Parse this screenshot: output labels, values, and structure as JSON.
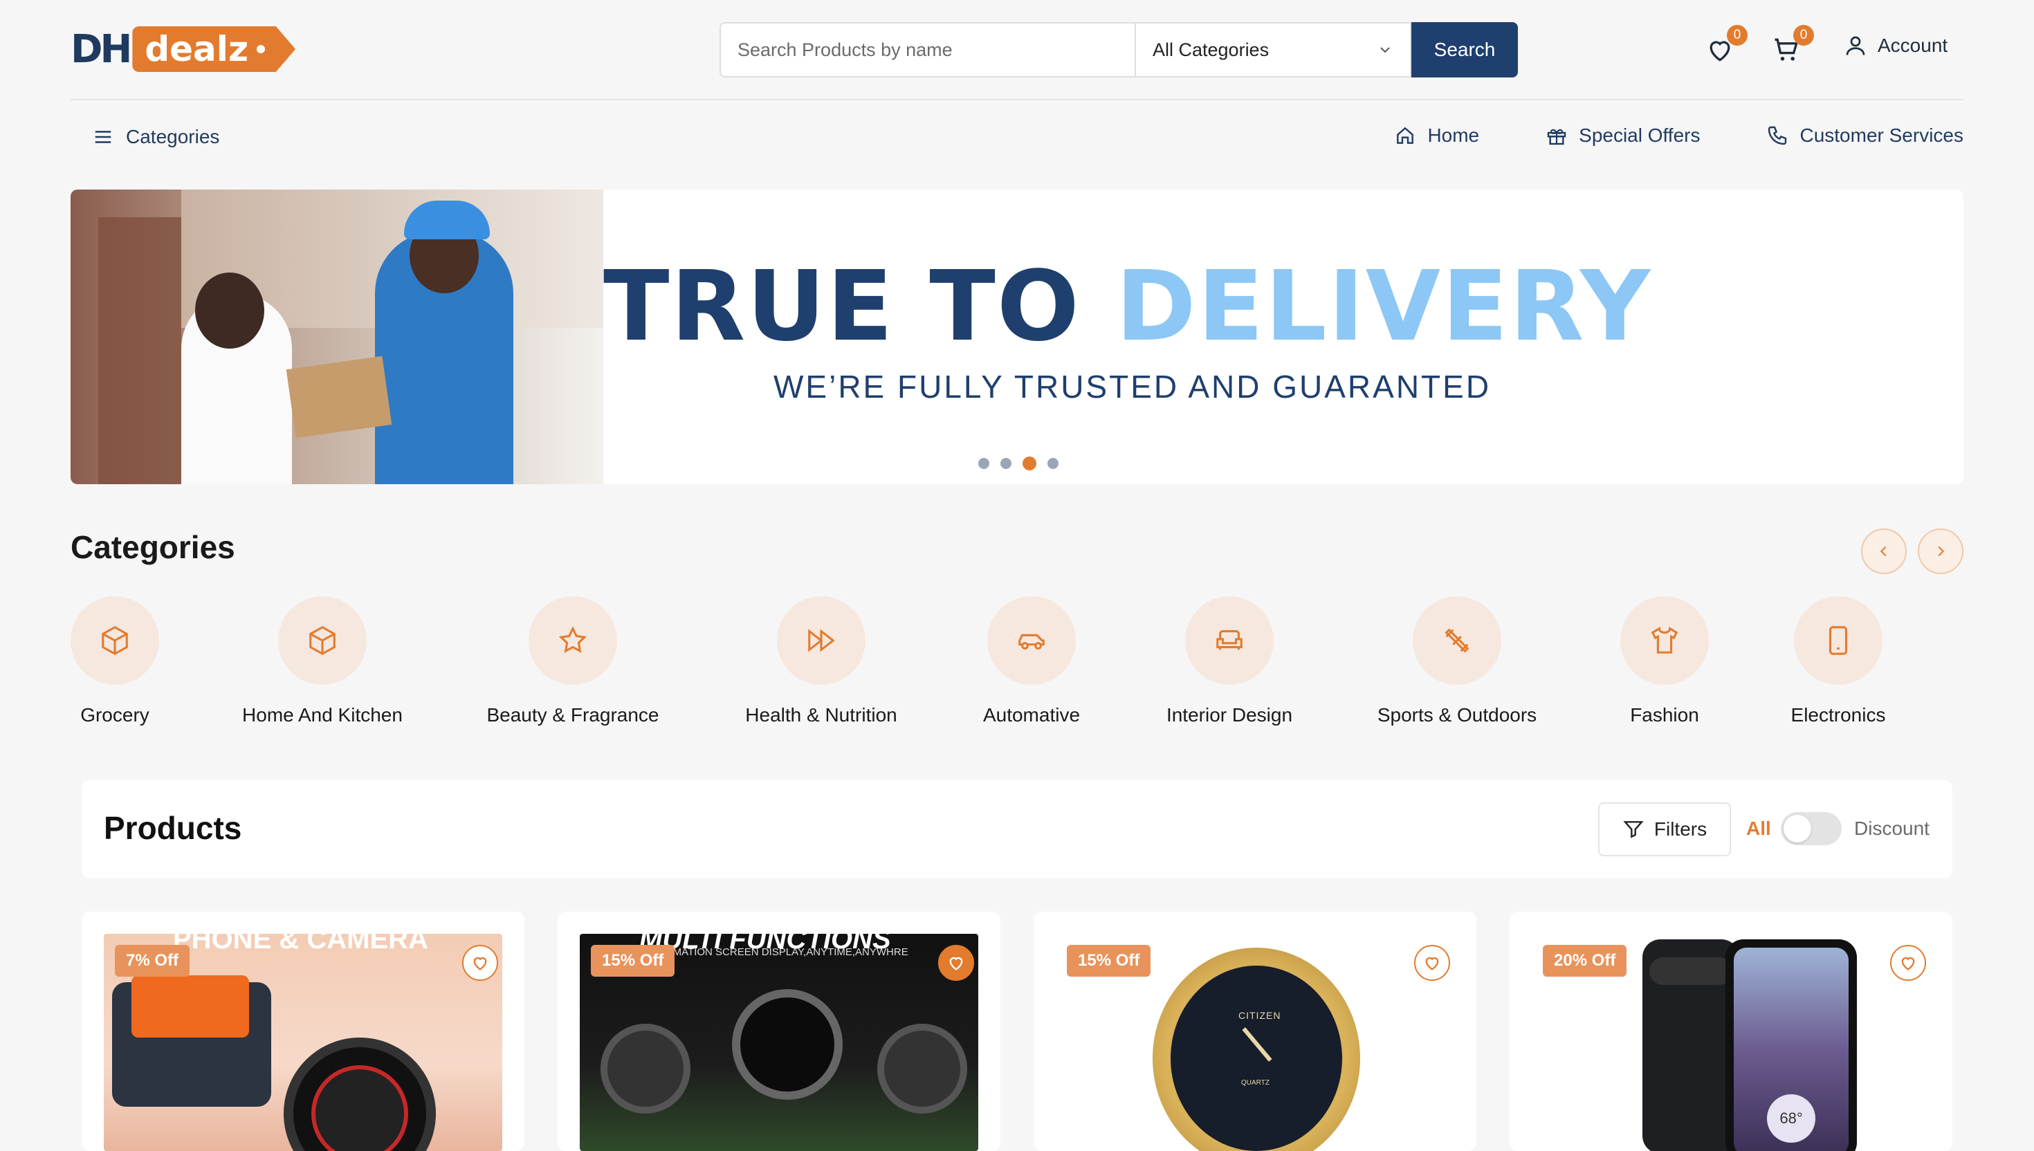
{
  "brand": {
    "logo_mark": "DH",
    "logo_text": "dealz"
  },
  "header": {
    "search_placeholder": "Search Products by name",
    "category_select": "All Categories",
    "search_button": "Search",
    "wishlist_count": "0",
    "cart_count": "0",
    "account_label": "Account"
  },
  "nav": {
    "categories_label": "Categories",
    "items": [
      {
        "label": "Home",
        "icon": "home-icon"
      },
      {
        "label": "Special Offers",
        "icon": "gift-icon"
      },
      {
        "label": "Customer Services",
        "icon": "phone-icon"
      }
    ]
  },
  "banner": {
    "title_part1": "TRUE TO ",
    "title_part2": "DELIVERY",
    "subtitle": "WE’RE FULLY TRUSTED AND GUARANTED",
    "slides_total": 4,
    "active_slide": 3
  },
  "categories": {
    "title": "Categories",
    "items": [
      {
        "label": "Grocery",
        "icon": "box-icon"
      },
      {
        "label": "Home And Kitchen",
        "icon": "box-icon"
      },
      {
        "label": "Beauty & Fragrance",
        "icon": "star-icon"
      },
      {
        "label": "Health & Nutrition",
        "icon": "fast-forward-icon"
      },
      {
        "label": "Automative",
        "icon": "car-icon"
      },
      {
        "label": "Interior Design",
        "icon": "sofa-icon"
      },
      {
        "label": "Sports & Outdoors",
        "icon": "dumbbell-icon"
      },
      {
        "label": "Fashion",
        "icon": "shirt-icon"
      },
      {
        "label": "Electronics",
        "icon": "tablet-icon"
      }
    ]
  },
  "products": {
    "title": "Products",
    "filters_label": "Filters",
    "toggle_all": "All",
    "toggle_discount": "Discount",
    "discount_on": false,
    "cards": [
      {
        "discount": "7% Off",
        "image_text": "PHONE & CAMERA"
      },
      {
        "discount": "15% Off",
        "image_text": "MULTI FUNCTIONS",
        "image_subtext": "INFORMATION SCREEN DISPLAY,ANYTIME,ANYWHRE"
      },
      {
        "discount": "15% Off",
        "image_text": "CITIZEN",
        "image_subtext": "QUARTZ"
      },
      {
        "discount": "20% Off",
        "image_text": "68°"
      }
    ]
  },
  "colors": {
    "accent": "#e37b2e",
    "primary": "#1f3f6e",
    "light_blue": "#8cc7f5"
  }
}
